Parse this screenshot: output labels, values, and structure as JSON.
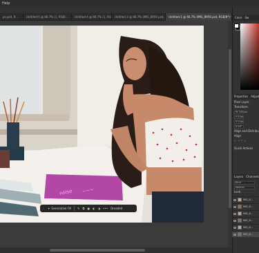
{
  "menubar": {
    "help_label": "Help"
  },
  "tabs": [
    {
      "label": "ps.psd, R...",
      "active": false
    },
    {
      "label": "Untitled-5 @ 66.7% (1, RGB/...",
      "active": false
    },
    {
      "label": "Untitled-4 @ 66.7% (1, RGB/...",
      "active": false
    },
    {
      "label": "Untitled-3 @ 66.7% (IMG_8959.psd, RGB...",
      "active": false
    },
    {
      "label": "Untitled-1 @ 66.7% (IMG_8959.psd, RGB/8*) *",
      "active": true
    }
  ],
  "context_bar": {
    "generative_fill_label": "Generative Fill",
    "dropdown_label": "Dreaded"
  },
  "right_panel": {
    "color_tab": "Color",
    "swatches_tab": "Sw",
    "properties_tab": "Properties",
    "adjustments_tab": "Adjustm",
    "pixel_layer_label": "Pixel Layer",
    "transform_label": "Transform",
    "w_value": "W 545 px",
    "h_value": "H 0 px",
    "x_value": "X 0 px",
    "angle_value": "0.00°",
    "align_label": "Align and Distribute",
    "align_sub": "Align",
    "quick_actions_label": "Quick Actions",
    "layers_tab": "Layers",
    "channels_tab": "Channels",
    "kind_label": "Kind",
    "normal_label": "Normal",
    "lock_label": "Lock:",
    "layers": [
      "IMG_8...",
      "IMG_8...",
      "IMG_8...",
      "IMG_8...",
      "IMG_8...",
      "IMG_8..."
    ]
  }
}
